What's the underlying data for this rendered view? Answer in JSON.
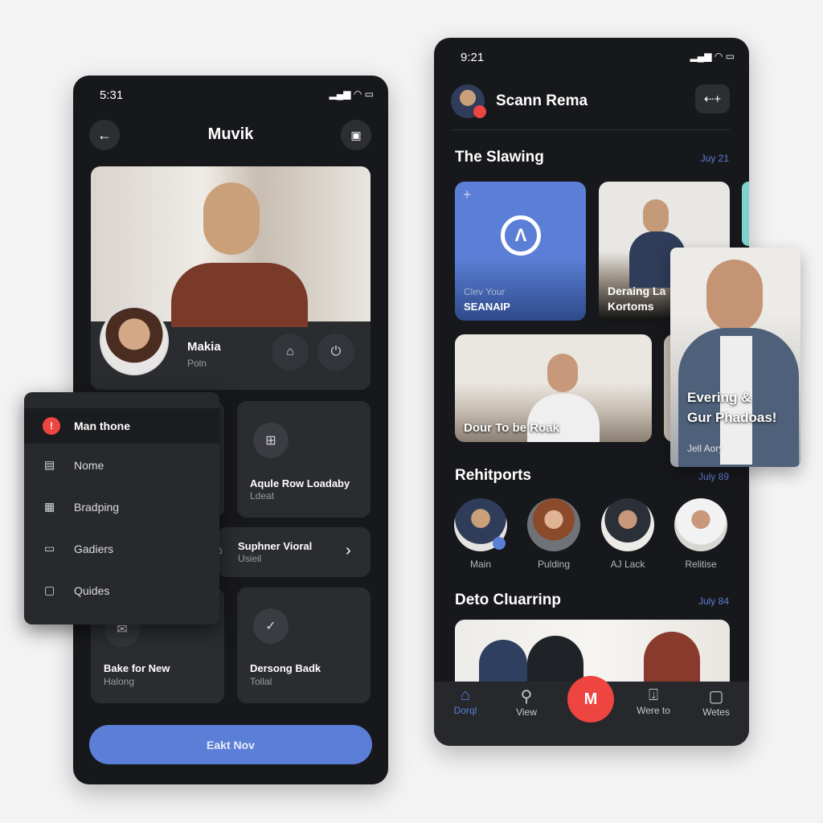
{
  "left": {
    "status_time": "5:31",
    "title": "Muvik",
    "profile": {
      "name": "Makia",
      "sub": "Poln"
    },
    "cards": [
      {
        "title": "Aqule Row Loadaby",
        "sub": "Ldeat"
      },
      {
        "title": "Suphner Vioral",
        "sub": "Usieil"
      },
      {
        "title": "Bake for New",
        "sub": "Halong"
      },
      {
        "title": "Dersong Badk",
        "sub": "Tollal"
      }
    ],
    "button": "Eakt Nov",
    "menu": [
      {
        "label": "Man thone",
        "icon": "alert-icon"
      },
      {
        "label": "Nome",
        "icon": "home-icon"
      },
      {
        "label": "Bradping",
        "icon": "save-icon"
      },
      {
        "label": "Gadiers",
        "icon": "folder-icon"
      },
      {
        "label": "Quides",
        "icon": "chat-icon"
      }
    ]
  },
  "right": {
    "status_time": "9:21",
    "user": "Scann Rema",
    "section1": {
      "title": "The Slawing",
      "date": "Juy 21"
    },
    "tiles": [
      {
        "line1": "Clev Your",
        "line2": "SEANAIP"
      },
      {
        "line1": "Deraing La",
        "line2": "Kortoms"
      },
      {
        "line1": "Dour To be Roak"
      }
    ],
    "float_card": {
      "title1": "Evering &",
      "title2": "Gur Phadoas!",
      "sub": "Jell Aory"
    },
    "section2": {
      "title": "Rehitports",
      "date": "July 89"
    },
    "people": [
      "Main",
      "Pulding",
      "AJ Lack",
      "Relitise"
    ],
    "section3": {
      "title": "Deto Cluarrinp",
      "date": "July 84"
    },
    "nav": [
      {
        "label": "Dorql",
        "icon": "home-icon",
        "active": true
      },
      {
        "label": "View",
        "icon": "search-icon"
      },
      {
        "label": "Were to",
        "icon": "share-icon"
      },
      {
        "label": "Wetes",
        "icon": "chat-icon"
      }
    ],
    "accent": "#5b7fd6",
    "record_color": "#ee4540"
  }
}
